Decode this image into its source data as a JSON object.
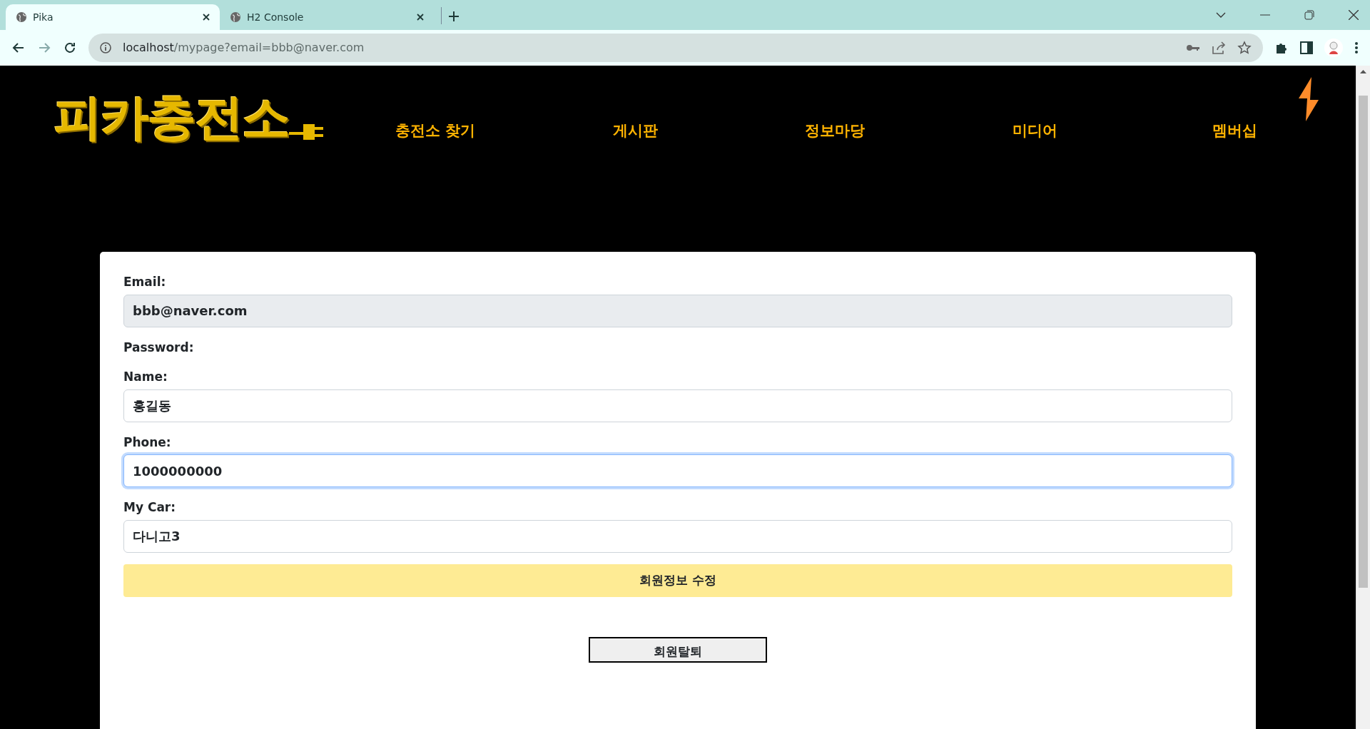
{
  "browser": {
    "tabs": [
      {
        "title": "Pika",
        "selected": true
      },
      {
        "title": "H2 Console",
        "selected": false
      }
    ],
    "address": {
      "host": "localhost",
      "path": "/mypage?email=bbb@naver.com"
    }
  },
  "site": {
    "logo": "피카충전소",
    "nav": [
      "충전소 찾기",
      "게시판",
      "정보마당",
      "미디어",
      "멤버십"
    ]
  },
  "form": {
    "fields": [
      {
        "kind": "input",
        "label": "Email:",
        "value": "bbb@naver.com",
        "readonly": true,
        "focused": false
      },
      {
        "kind": "label",
        "label": "Password:"
      },
      {
        "kind": "input",
        "label": "Name:",
        "value": "홍길동",
        "readonly": false,
        "focused": false
      },
      {
        "kind": "input",
        "label": "Phone:",
        "value": "1000000000",
        "readonly": false,
        "focused": true
      },
      {
        "kind": "input",
        "label": "My Car:",
        "value": "다니고3",
        "readonly": false,
        "focused": false
      }
    ],
    "buttons": [
      {
        "kind": "primary",
        "label": "회원정보 수정"
      },
      {
        "kind": "outline",
        "label": "회원탈퇴"
      }
    ]
  }
}
